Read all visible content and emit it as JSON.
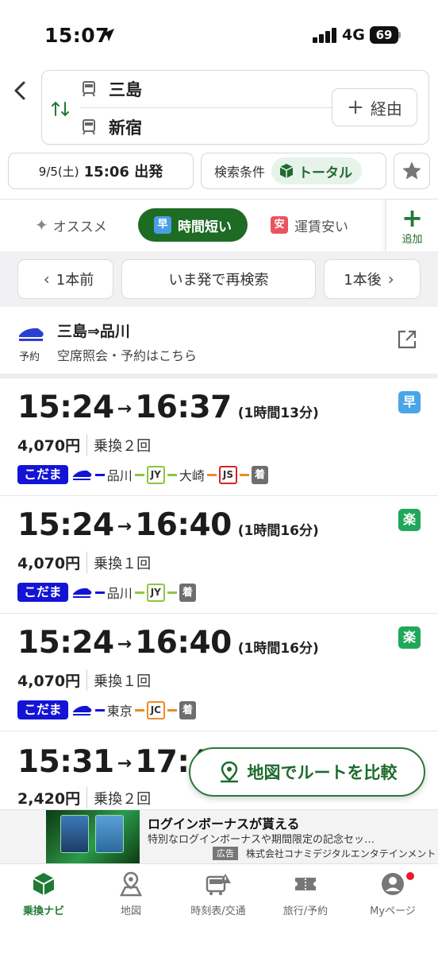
{
  "status_bar": {
    "time": "15:07",
    "network": "4G",
    "battery": "69"
  },
  "search": {
    "from_station": "三島",
    "to_station": "新宿",
    "via_label": "経由",
    "date": "9/5(土)",
    "time": "15:06 出発",
    "conditions_label": "検索条件",
    "conditions_value": "トータル"
  },
  "sort_tabs": {
    "recommended": "オススメ",
    "fast_badge": "早",
    "fast": "時間短い",
    "cheap_badge": "安",
    "cheap": "運賃安い",
    "add": "追加"
  },
  "nav": {
    "prev": "1本前",
    "now": "いま発で再検索",
    "next": "1本後"
  },
  "booking": {
    "label": "予約",
    "title": "三島⇒品川",
    "subtitle": "空席照会・予約はこちら"
  },
  "routes": [
    {
      "depart": "15:24",
      "arrive": "16:37",
      "duration": "(1時間13分)",
      "fare": "4,070円",
      "transfers": "乗換２回",
      "badge": "早",
      "train": "こだま",
      "stops": [
        "品川",
        "大崎"
      ],
      "lines": [
        "JY",
        "JS"
      ],
      "arrive_label": "着"
    },
    {
      "depart": "15:24",
      "arrive": "16:40",
      "duration": "(1時間16分)",
      "fare": "4,070円",
      "transfers": "乗換１回",
      "badge": "楽",
      "train": "こだま",
      "stops": [
        "品川"
      ],
      "lines": [
        "JY"
      ],
      "arrive_label": "着"
    },
    {
      "depart": "15:24",
      "arrive": "16:40",
      "duration": "(1時間16分)",
      "fare": "4,070円",
      "transfers": "乗換１回",
      "badge": "楽",
      "train": "こだま",
      "stops": [
        "東京"
      ],
      "lines": [
        "JC"
      ],
      "arrive_label": "着"
    },
    {
      "depart": "15:31",
      "arrive": "17:4",
      "fare": "2,420円",
      "transfers": "乗換２回"
    }
  ],
  "map_button": "地図でルートを比較",
  "ad": {
    "title": "ログインボーナスが貰える",
    "description": "特別なログインボーナスや期間限定の記念セッ…",
    "tag": "広告",
    "sponsor": "株式会社コナミデジタルエンタテインメント"
  },
  "tabbar": [
    "乗換ナビ",
    "地図",
    "時刻表/交通",
    "旅行/予約",
    "Myページ"
  ],
  "colors": {
    "brand_green": "#1e6b24",
    "kodama_blue": "#1414d6",
    "badge_fast": "#4aa5e8",
    "badge_easy": "#1fa85a"
  }
}
